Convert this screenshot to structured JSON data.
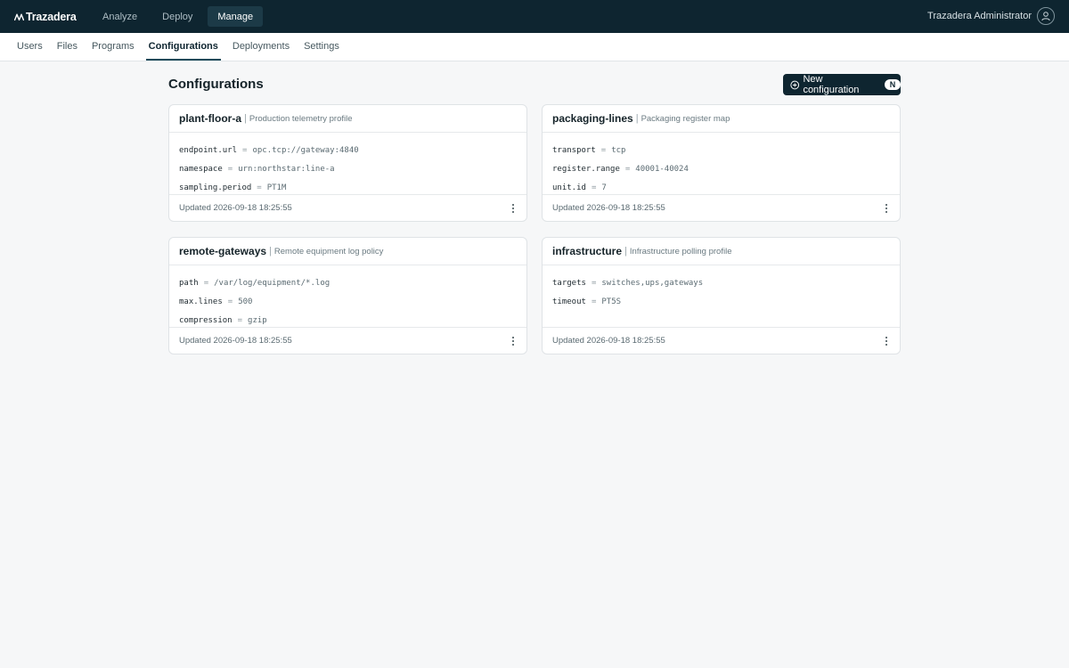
{
  "app": {
    "brand": "Trazadera"
  },
  "topnav": {
    "items": [
      {
        "label": "Analyze"
      },
      {
        "label": "Deploy"
      },
      {
        "label": "Manage"
      }
    ],
    "active": "Manage"
  },
  "user": {
    "name": "Trazadera Administrator",
    "icon": "user-icon"
  },
  "subnav": {
    "items": [
      {
        "label": "Users"
      },
      {
        "label": "Files"
      },
      {
        "label": "Programs"
      },
      {
        "label": "Configurations"
      },
      {
        "label": "Deployments"
      },
      {
        "label": "Settings"
      }
    ],
    "active": "Configurations"
  },
  "page": {
    "title": "Configurations",
    "new_button": {
      "label": "New configuration",
      "shortcut": "N",
      "icon": "plus-circle-icon"
    }
  },
  "cards": [
    {
      "name": "plant-floor-a",
      "separator": "|",
      "description": "Production telemetry profile",
      "entries": [
        {
          "key": "endpoint.url",
          "eq": "=",
          "value": "opc.tcp://gateway:4840"
        },
        {
          "key": "namespace",
          "eq": "=",
          "value": "urn:northstar:line-a"
        },
        {
          "key": "sampling.period",
          "eq": "=",
          "value": "PT1M"
        }
      ],
      "updated": "Updated 2026-09-18 18:25:55"
    },
    {
      "name": "packaging-lines",
      "separator": "|",
      "description": "Packaging register map",
      "entries": [
        {
          "key": "transport",
          "eq": "=",
          "value": "tcp"
        },
        {
          "key": "register.range",
          "eq": "=",
          "value": "40001-40024"
        },
        {
          "key": "unit.id",
          "eq": "=",
          "value": "7"
        }
      ],
      "updated": "Updated 2026-09-18 18:25:55"
    },
    {
      "name": "remote-gateways",
      "separator": "|",
      "description": "Remote equipment log policy",
      "entries": [
        {
          "key": "path",
          "eq": "=",
          "value": "/var/log/equipment/*.log"
        },
        {
          "key": "max.lines",
          "eq": "=",
          "value": "500"
        },
        {
          "key": "compression",
          "eq": "=",
          "value": "gzip"
        }
      ],
      "updated": "Updated 2026-09-18 18:25:55"
    },
    {
      "name": "infrastructure",
      "separator": "|",
      "description": "Infrastructure polling profile",
      "entries": [
        {
          "key": "targets",
          "eq": "=",
          "value": "switches,ups,gateways"
        },
        {
          "key": "timeout",
          "eq": "=",
          "value": "PT5S"
        }
      ],
      "updated": "Updated 2026-09-18 18:25:55"
    }
  ]
}
